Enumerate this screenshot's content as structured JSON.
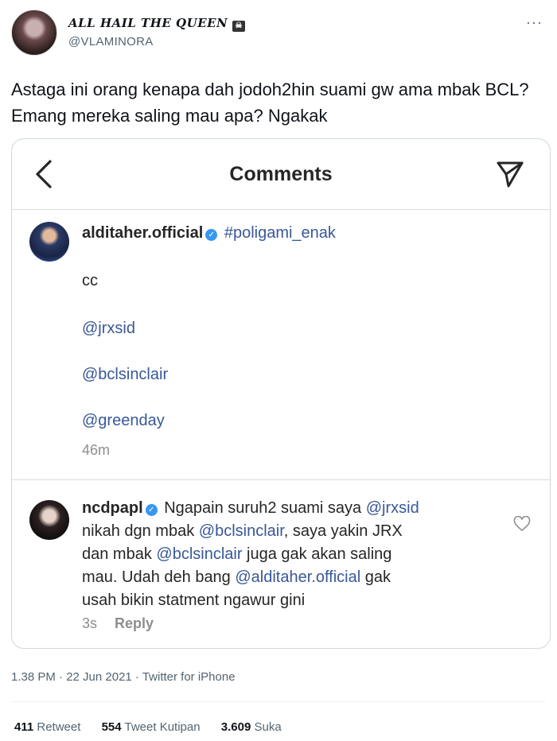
{
  "author": {
    "display_name": "ALL HAIL THE QUEEN",
    "handle": "@VLAMINORA"
  },
  "tweet": {
    "text": "Astaga ini orang kenapa dah jodoh2hin suami gw ama mbak BCL? Emang mereka saling mau apa? Ngakak"
  },
  "embed": {
    "title": "Comments",
    "comment1": {
      "username": "alditaher.official",
      "hashtag": "#poligami_enak",
      "cc": "cc",
      "mention1": "@jrxsid",
      "mention2": "@bclsinclair",
      "mention3": "@greenday",
      "time": "46m"
    },
    "comment2": {
      "username": "ncdpapl",
      "line1_text": "Ngapain suruh2 suami saya ",
      "line1_mention": "@jrxsid",
      "line2_text": "nikah dgn mbak ",
      "line2_mention": "@bclsinclair",
      "line2_tail": ", saya yakin JRX",
      "line3_text": "dan mbak ",
      "line3_mention": "@bclsinclair",
      "line3_tail": " juga gak akan saling",
      "line4_text": "mau. Udah deh bang ",
      "line4_mention": "@alditaher.official",
      "line4_tail": " gak",
      "line5_text": "usah bikin statment ngawur gini",
      "time": "3s",
      "reply_label": "Reply"
    }
  },
  "footer": {
    "timestamp": "1.38 PM · 22 Jun 2021 · Twitter for iPhone",
    "retweets_count": "411",
    "retweets_label": "Retweet",
    "quotes_count": "554",
    "quotes_label": "Tweet Kutipan",
    "likes_count": "3.609",
    "likes_label": "Suka"
  },
  "icons": {
    "more": "more-icon",
    "skull": "skull-crossbones-icon",
    "back": "chevron-left-icon",
    "send": "paper-plane-icon",
    "verified": "verified-badge-icon",
    "heart": "heart-icon"
  }
}
